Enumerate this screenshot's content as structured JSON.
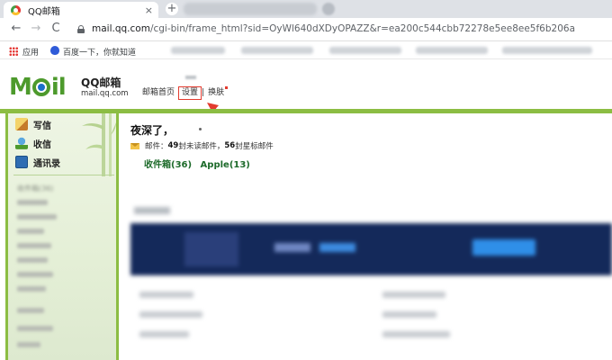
{
  "browser": {
    "tab_title": "QQ邮箱",
    "tab_close": "×",
    "new_tab": "+",
    "url_host": "mail.qq.com",
    "url_path": "/cgi-bin/frame_html?sid=OyWl640dXDyOPAZZ&r=ea200c544cbb72278e5ee8ee5f6b206a",
    "nav_back": "←",
    "nav_forward": "→",
    "nav_reload": "C"
  },
  "bookmarks": {
    "apps_label": "应用",
    "baidu_label": "百度一下，你就知道"
  },
  "header": {
    "logo_m": "M",
    "logo_il": "il",
    "logo_cn": "QQ邮箱",
    "logo_domain": "mail.qq.com",
    "link_home": "邮箱首页",
    "link_settings": "设置",
    "link_skin": "换肤",
    "separator": "|"
  },
  "sidebar": {
    "items": [
      {
        "label": "写信",
        "icon": "compose-icon"
      },
      {
        "label": "收信",
        "icon": "inbox-icon"
      },
      {
        "label": "通讯录",
        "icon": "contacts-icon"
      }
    ],
    "folder_title": "收件箱(36)"
  },
  "main": {
    "greeting": "夜深了，",
    "stats_prefix": "邮件：",
    "unread_count": "49",
    "unread_label": " 封未读邮件，",
    "starred_count": "56",
    "starred_label": " 封星标邮件",
    "folders": [
      "收件箱(36)",
      "Apple(13)"
    ]
  },
  "colors": {
    "accent_green": "#8cbd43",
    "logo_green": "#4d9a2c",
    "highlight_red": "#e33b2f",
    "folder_link": "#1d6a2a",
    "banner_navy": "#14295a"
  }
}
